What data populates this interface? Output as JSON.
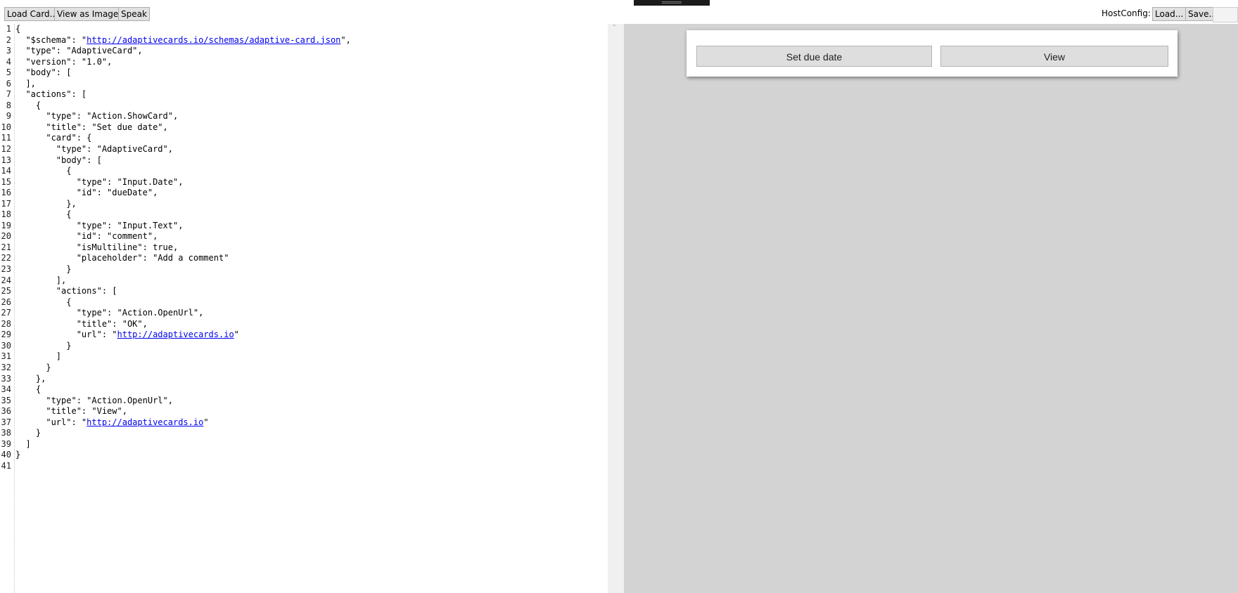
{
  "toolbar": {
    "load_card": "Load Card...",
    "view_as_image": "View as Image",
    "speak": "Speak",
    "hostconfig_label": "HostConfig:",
    "hostconfig_load": "Load...",
    "hostconfig_save": "Save..."
  },
  "editor": {
    "lines": [
      "{",
      "  \"$schema\": \"[[http://adaptivecards.io/schemas/adaptive-card.json]]\",",
      "  \"type\": \"AdaptiveCard\",",
      "  \"version\": \"1.0\",",
      "  \"body\": [",
      "  ],",
      "  \"actions\": [",
      "    {",
      "      \"type\": \"Action.ShowCard\",",
      "      \"title\": \"Set due date\",",
      "      \"card\": {",
      "        \"type\": \"AdaptiveCard\",",
      "        \"body\": [",
      "          {",
      "            \"type\": \"Input.Date\",",
      "            \"id\": \"dueDate\",",
      "          },",
      "          {",
      "            \"type\": \"Input.Text\",",
      "            \"id\": \"comment\",",
      "            \"isMultiline\": true,",
      "            \"placeholder\": \"Add a comment\"",
      "          }",
      "        ],",
      "        \"actions\": [",
      "          {",
      "            \"type\": \"Action.OpenUrl\",",
      "            \"title\": \"OK\",",
      "            \"url\": \"[[http://adaptivecards.io]]\"",
      "          }",
      "        ]",
      "      }",
      "    },",
      "    {",
      "      \"type\": \"Action.OpenUrl\",",
      "      \"title\": \"View\",",
      "      \"url\": \"[[http://adaptivecards.io]]\"",
      "    }",
      "  ]",
      "}",
      ""
    ]
  },
  "preview": {
    "actions": [
      {
        "label": "Set due date"
      },
      {
        "label": "View"
      }
    ]
  },
  "colors": {
    "preview_background": "#d3d3d3",
    "link": "#0000ee"
  }
}
